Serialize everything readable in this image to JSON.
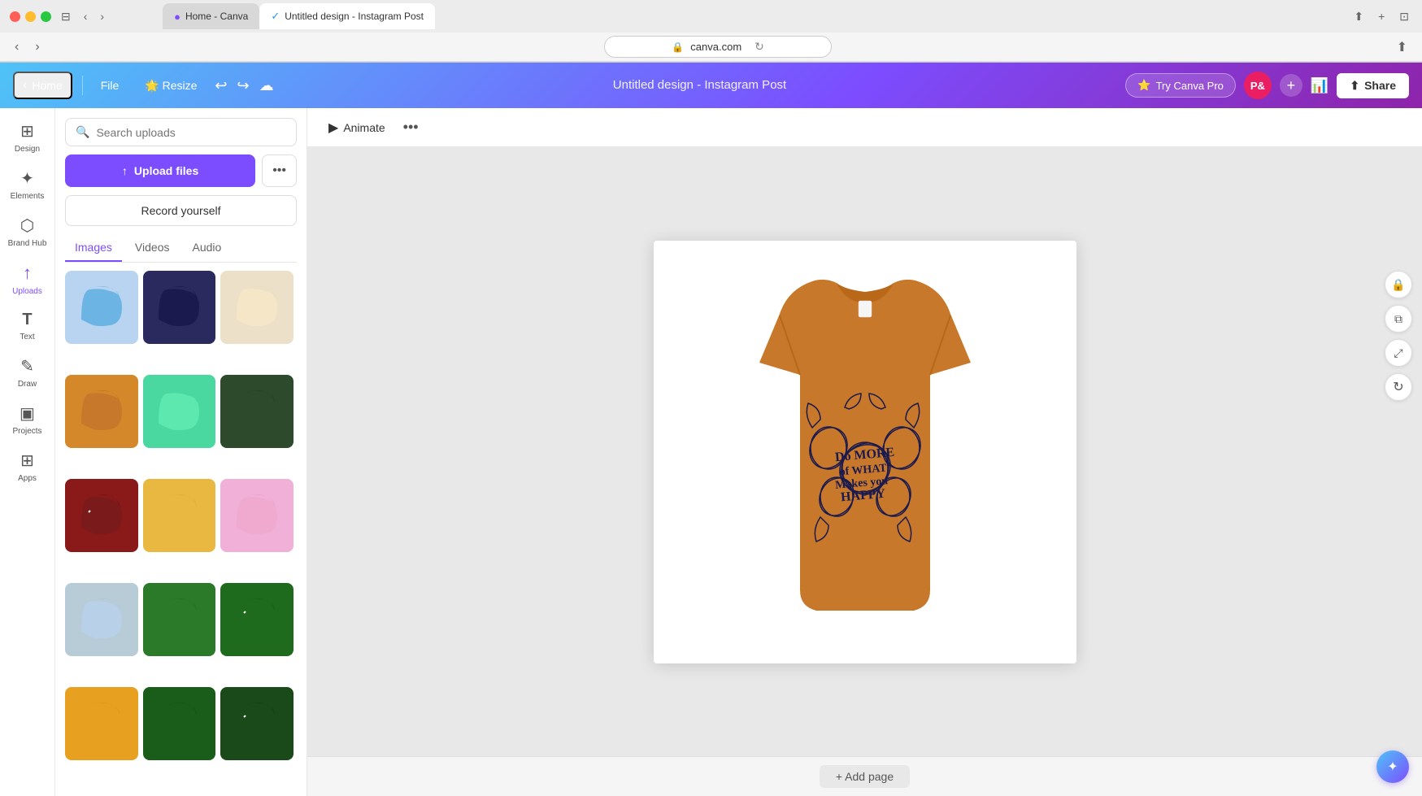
{
  "browser": {
    "tab1_label": "Home - Canva",
    "tab2_label": "Untitled design - Instagram Post",
    "address": "canva.com"
  },
  "toolbar": {
    "home_label": "Home",
    "file_label": "File",
    "resize_label": "Resize",
    "title": "Untitled design - Instagram Post",
    "try_pro_label": "Try Canva Pro",
    "share_label": "Share",
    "user_initials": "P&"
  },
  "left_sidebar": {
    "items": [
      {
        "id": "design",
        "label": "Design",
        "icon": "⊞"
      },
      {
        "id": "elements",
        "label": "Elements",
        "icon": "✦"
      },
      {
        "id": "brand-hub",
        "label": "Brand Hub",
        "icon": "⬡"
      },
      {
        "id": "uploads",
        "label": "Uploads",
        "icon": "↑"
      },
      {
        "id": "text",
        "label": "Text",
        "icon": "T"
      },
      {
        "id": "draw",
        "label": "Draw",
        "icon": "✎"
      },
      {
        "id": "projects",
        "label": "Projects",
        "icon": "▣"
      },
      {
        "id": "apps",
        "label": "Apps",
        "icon": "⊞"
      }
    ]
  },
  "upload_panel": {
    "search_placeholder": "Search uploads",
    "upload_files_label": "Upload files",
    "more_label": "•••",
    "record_label": "Record yourself",
    "tabs": [
      "Images",
      "Videos",
      "Audio"
    ],
    "active_tab": "Images"
  },
  "canvas": {
    "animate_label": "Animate",
    "add_page_label": "+ Add page"
  },
  "tshirt_colors": [
    "#6cb4e4",
    "#1a1a4e",
    "#f5e6c8",
    "#c8782a",
    "#5de8b0",
    "#2d4a2d",
    "#7a1a1a",
    "#e8b840",
    "#f0aad0",
    "#b8d0e8",
    "#2a7a2a",
    "#1e6b1e",
    "#e8a020",
    "#1a5c1a",
    "#1a4a1a"
  ]
}
